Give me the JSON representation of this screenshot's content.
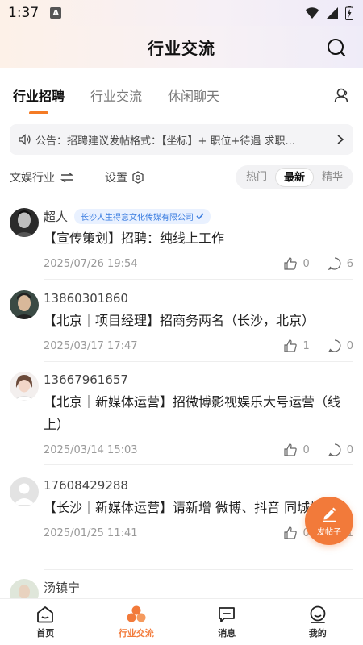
{
  "status": {
    "time": "1:37",
    "badge": "A"
  },
  "header": {
    "title": "行业交流"
  },
  "tabs": [
    {
      "label": "行业招聘",
      "active": true
    },
    {
      "label": "行业交流",
      "active": false
    },
    {
      "label": "休闲聊天",
      "active": false
    }
  ],
  "notice": {
    "text": "公告：招聘建议发帖格式：【坐标】+ 职位+待遇  求职..."
  },
  "filter": {
    "category": "文娱行业",
    "settings": "设置",
    "sort": [
      {
        "label": "热门",
        "active": false
      },
      {
        "label": "最新",
        "active": true
      },
      {
        "label": "精华",
        "active": false
      }
    ]
  },
  "posts": [
    {
      "name": "超人",
      "company": "长沙人生得意文化传媒有限公司",
      "content": "【宣传策划】招聘：纯线上工作",
      "date": "2025/07/26 19:54",
      "likes": "0",
      "comments": "6"
    },
    {
      "name": "13860301860",
      "company": "",
      "content": "【北京｜项目经理】招商务两名（长沙，北京）",
      "date": "2025/03/17 17:47",
      "likes": "1",
      "comments": "0"
    },
    {
      "name": "13667961657",
      "company": "",
      "content": "【北京｜新媒体运营】招微博影视娱乐大号运营（线上）",
      "date": "2025/03/14 15:03",
      "likes": "0",
      "comments": "0"
    },
    {
      "name": "17608429288",
      "company": "",
      "content": "【长沙｜新媒体运营】请新增 微博、抖音 同城搜！",
      "date": "2025/01/25 11:41",
      "likes": "0",
      "comments": "1"
    },
    {
      "name": "汤镇宁",
      "company": "",
      "content": "",
      "date": "",
      "likes": "",
      "comments": ""
    }
  ],
  "fab": {
    "label": "发帖子"
  },
  "nav": [
    {
      "label": "首页",
      "active": false
    },
    {
      "label": "行业交流",
      "active": true
    },
    {
      "label": "消息",
      "active": false
    },
    {
      "label": "我的",
      "active": false
    }
  ],
  "colors": {
    "accent": "#f27a3a",
    "badge_blue": "#3a7de0"
  }
}
